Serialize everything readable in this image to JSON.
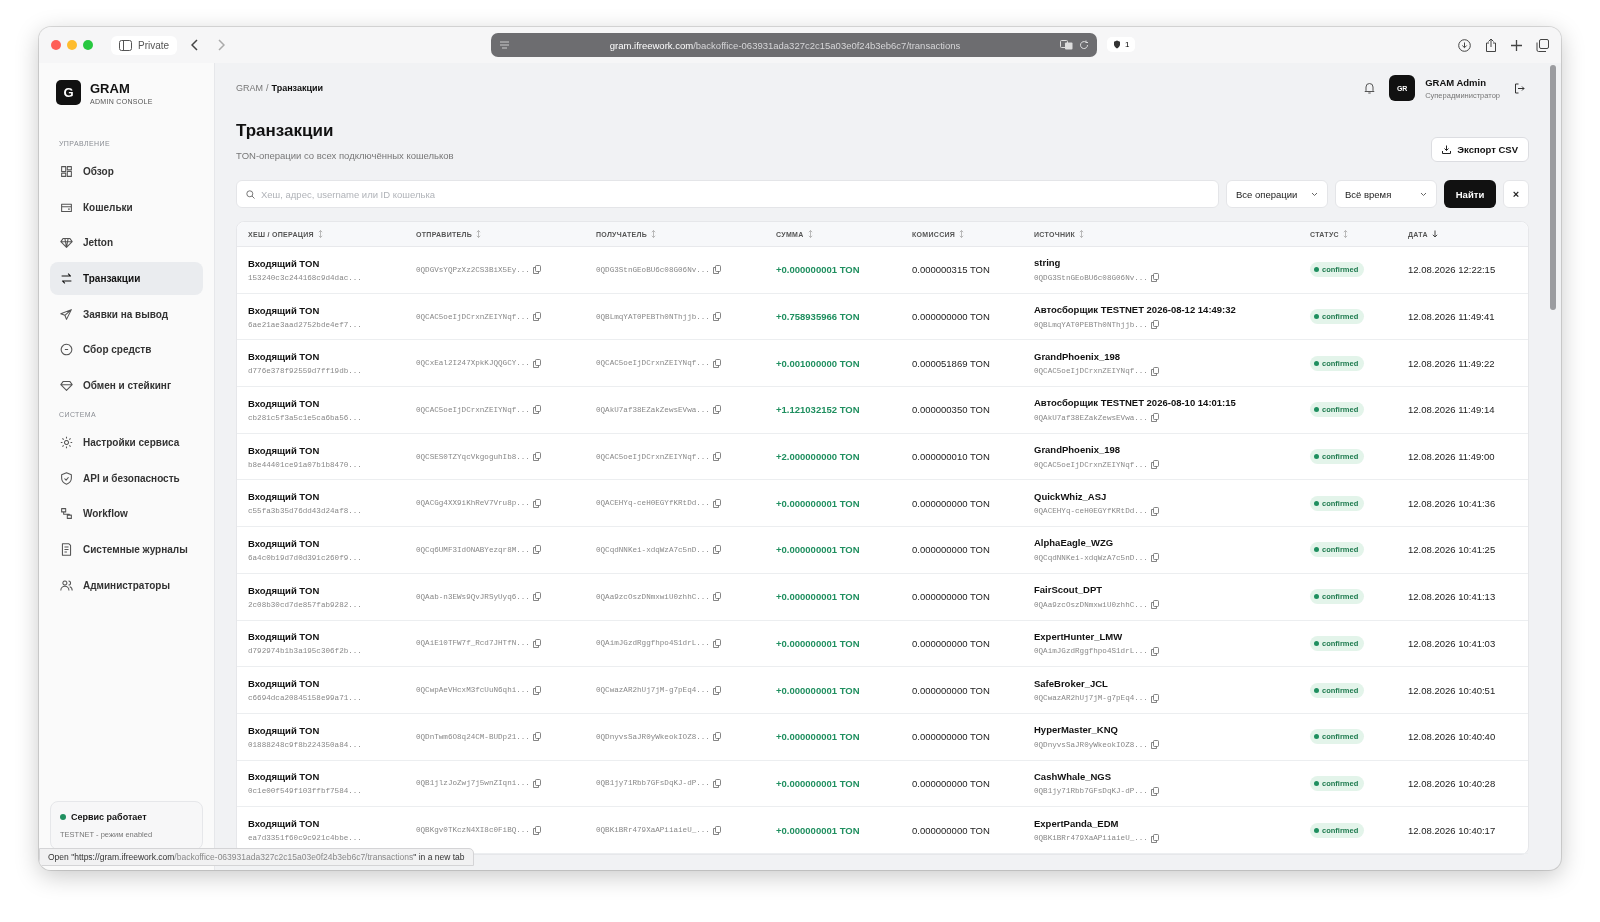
{
  "browser": {
    "mode_label": "Private",
    "url_host": "gram.ifreework.com",
    "url_path": "/backoffice-063931ada327c2c15a03e0f24b3eb6c7/transactions",
    "tracker_count": "1"
  },
  "sidebar": {
    "logo_letter": "G",
    "title": "GRAM",
    "subtitle": "ADMIN CONSOLE",
    "sections": [
      {
        "heading": "УПРАВЛЕНИЕ",
        "items": [
          {
            "label": "Обзор",
            "selected": false
          },
          {
            "label": "Кошельки",
            "selected": false
          },
          {
            "label": "Jetton",
            "selected": false
          },
          {
            "label": "Транзакции",
            "selected": true
          },
          {
            "label": "Заявки на вывод",
            "selected": false
          },
          {
            "label": "Сбор средств",
            "selected": false
          },
          {
            "label": "Обмен и стейкинг",
            "selected": false
          }
        ]
      },
      {
        "heading": "СИСТЕМА",
        "items": [
          {
            "label": "Настройки сервиса",
            "selected": false
          },
          {
            "label": "API и безопасность",
            "selected": false
          },
          {
            "label": "Workflow",
            "selected": false
          },
          {
            "label": "Системные журналы",
            "selected": false
          },
          {
            "label": "Администраторы",
            "selected": false
          }
        ]
      }
    ],
    "status": {
      "label": "Сервис работает",
      "online": true,
      "note": "TESTNET - режим enabled"
    }
  },
  "breadcrumb": {
    "root": "GRAM",
    "separator": "/",
    "current": "Транзакции"
  },
  "user": {
    "initials": "GR",
    "name": "GRAM Admin",
    "role": "Суперадминистратор"
  },
  "page": {
    "title": "Транзакции",
    "subtitle": "TON-операции со всех подключённых кошельков",
    "export_button": "Экспорт CSV"
  },
  "filters": {
    "search_placeholder": "Хеш, адрес, username или ID кошелька",
    "operation_select": "Все операции",
    "period_select": "Всё время",
    "search_button": "Найти",
    "clear_button": "×"
  },
  "table": {
    "columns": [
      {
        "label": "ХЕШ / ОПЕРАЦИЯ",
        "sorted": false
      },
      {
        "label": "ОТПРАВИТЕЛЬ",
        "sorted": false
      },
      {
        "label": "ПОЛУЧАТЕЛЬ",
        "sorted": false
      },
      {
        "label": "СУММА",
        "sorted": false
      },
      {
        "label": "КОМИССИЯ",
        "sorted": false
      },
      {
        "label": "ИСТОЧНИК",
        "sorted": false
      },
      {
        "label": "СТАТУС",
        "sorted": false
      },
      {
        "label": "ДАТА",
        "sorted": true
      }
    ],
    "rows": [
      {
        "operation": "Входящий TON",
        "hash": "153240c3c244168c9d4dac...",
        "sender": "0QDGVsYQPzXz2CS3BiX5Ey...",
        "receiver": "0QDG3StnGEoBU6c08G06Nv...",
        "amount": "+0.000000001 TON",
        "fee": "0.000000315 TON",
        "source_name": "string",
        "source_address": "0QDG3StnGEoBU6c08G06Nv...",
        "status": "confirmed",
        "date": "12.08.2026 12:22:15"
      },
      {
        "operation": "Входящий TON",
        "hash": "6ae21ae3aad2752bde4ef7...",
        "sender": "0QCAC5oeIjDCrxnZEIYNqf...",
        "receiver": "0QBLmqYAT0PEBTh0NThjjb...",
        "amount": "+0.758935966 TON",
        "fee": "0.000000000 TON",
        "source_name": "Автосборщик TESTNET 2026-08-12 14:49:32",
        "source_address": "0QBLmqYAT0PEBTh0NThjjb...",
        "status": "confirmed",
        "date": "12.08.2026 11:49:41"
      },
      {
        "operation": "Входящий TON",
        "hash": "d776e378f92559d7ff19db...",
        "sender": "0QCxEal2I247XpkKJQQGCY...",
        "receiver": "0QCAC5oeIjDCrxnZEIYNqf...",
        "amount": "+0.001000000 TON",
        "fee": "0.000051869 TON",
        "source_name": "GrandPhoenix_198",
        "source_address": "0QCAC5oeIjDCrxnZEIYNqf...",
        "status": "confirmed",
        "date": "12.08.2026 11:49:22"
      },
      {
        "operation": "Входящий TON",
        "hash": "cb281c5f3a5c1e5ca6ba56...",
        "sender": "0QCAC5oeIjDCrxnZEIYNqf...",
        "receiver": "0QAkU7af38EZakZewsEVwa...",
        "amount": "+1.121032152 TON",
        "fee": "0.000000350 TON",
        "source_name": "Автосборщик TESTNET 2026-08-10 14:01:15",
        "source_address": "0QAkU7af38EZakZewsEVwa...",
        "status": "confirmed",
        "date": "12.08.2026 11:49:14"
      },
      {
        "operation": "Входящий TON",
        "hash": "b8e44401ce91a07b1b8470...",
        "sender": "0QCSES0TZYqcVkgoguhIb8...",
        "receiver": "0QCAC5oeIjDCrxnZEIYNqf...",
        "amount": "+2.000000000 TON",
        "fee": "0.000000010 TON",
        "source_name": "GrandPhoenix_198",
        "source_address": "0QCAC5oeIjDCrxnZEIYNqf...",
        "status": "confirmed",
        "date": "12.08.2026 11:49:00"
      },
      {
        "operation": "Входящий TON",
        "hash": "c55fa3b35d76dd43d24af8...",
        "sender": "0QACGg4XX9iKhReV7Vru8p...",
        "receiver": "0QACEHYq-ceH0EGYfKRtDd...",
        "amount": "+0.000000001 TON",
        "fee": "0.000000000 TON",
        "source_name": "QuickWhiz_ASJ",
        "source_address": "0QACEHYq-ceH0EGYfKRtDd...",
        "status": "confirmed",
        "date": "12.08.2026 10:41:36"
      },
      {
        "operation": "Входящий TON",
        "hash": "6a4c0b19d7d0d391c260f9...",
        "sender": "0QCq6UMF3IdONABYezqr8M...",
        "receiver": "0QCqdNNKei-xdqWzA7c5nD...",
        "amount": "+0.000000001 TON",
        "fee": "0.000000000 TON",
        "source_name": "AlphaEagle_WZG",
        "source_address": "0QCqdNNKei-xdqWzA7c5nD...",
        "status": "confirmed",
        "date": "12.08.2026 10:41:25"
      },
      {
        "operation": "Входящий TON",
        "hash": "2c08b30cd7de857fab9282...",
        "sender": "0QAab-n3EWs9QvJRSyUyq6...",
        "receiver": "0QAa9zcOszDNmxwiU0zhhC...",
        "amount": "+0.000000001 TON",
        "fee": "0.000000000 TON",
        "source_name": "FairScout_DPT",
        "source_address": "0QAa9zcOszDNmxwiU0zhhC...",
        "status": "confirmed",
        "date": "12.08.2026 10:41:13"
      },
      {
        "operation": "Входящий TON",
        "hash": "d792974b1b3a195c306f2b...",
        "sender": "0QAiE10TFW7f_Rcd7JHTfN...",
        "receiver": "0QAimJGzdRggfhpo4S1drL...",
        "amount": "+0.000000001 TON",
        "fee": "0.000000000 TON",
        "source_name": "ExpertHunter_LMW",
        "source_address": "0QAimJGzdRggfhpo4S1drL...",
        "status": "confirmed",
        "date": "12.08.2026 10:41:03"
      },
      {
        "operation": "Входящий TON",
        "hash": "c6694dca20845158e99a71...",
        "sender": "0QCwpAeVHcxM3fcUuN6qhi...",
        "receiver": "0QCwazAR2hUj7jM-g7pEq4...",
        "amount": "+0.000000001 TON",
        "fee": "0.000000000 TON",
        "source_name": "SafeBroker_JCL",
        "source_address": "0QCwazAR2hUj7jM-g7pEq4...",
        "status": "confirmed",
        "date": "12.08.2026 10:40:51"
      },
      {
        "operation": "Входящий TON",
        "hash": "01888248c9f8b224350a84...",
        "sender": "0QDnTwm6O8q24CM-BUDp21...",
        "receiver": "0QDnyvsSaJR0yWkeokIOZ8...",
        "amount": "+0.000000001 TON",
        "fee": "0.000000000 TON",
        "source_name": "HyperMaster_KNQ",
        "source_address": "0QDnyvsSaJR0yWkeokIOZ8...",
        "status": "confirmed",
        "date": "12.08.2026 10:40:40"
      },
      {
        "operation": "Входящий TON",
        "hash": "0c1e00f549f103ffbf7584...",
        "sender": "0QB1jlzJoZwj7j5wnZIqni...",
        "receiver": "0QB1jy71Rbb7GFsDqKJ-dP...",
        "amount": "+0.000000001 TON",
        "fee": "0.000000000 TON",
        "source_name": "CashWhale_NGS",
        "source_address": "0QB1jy71Rbb7GFsDqKJ-dP...",
        "status": "confirmed",
        "date": "12.08.2026 10:40:28"
      },
      {
        "operation": "Входящий TON",
        "hash": "ea7d3351f60c9c921c4bbe...",
        "sender": "0QBKgv0TKczN4XI8c0FiBQ...",
        "receiver": "0QBKiBRr479XaAPiiaieU_...",
        "amount": "+0.000000001 TON",
        "fee": "0.000000000 TON",
        "source_name": "ExpertPanda_EDM",
        "source_address": "0QBKiBRr479XaAPiiaieU_...",
        "status": "confirmed",
        "date": "12.08.2026 10:40:17"
      }
    ]
  },
  "link_preview": {
    "before": "Open \"",
    "host": "https://gram.ifreework.com",
    "path": "/backoffice-063931ada327c2c15a03e0f24b3eb6c7/transactions",
    "after": "\" in a new tab"
  }
}
